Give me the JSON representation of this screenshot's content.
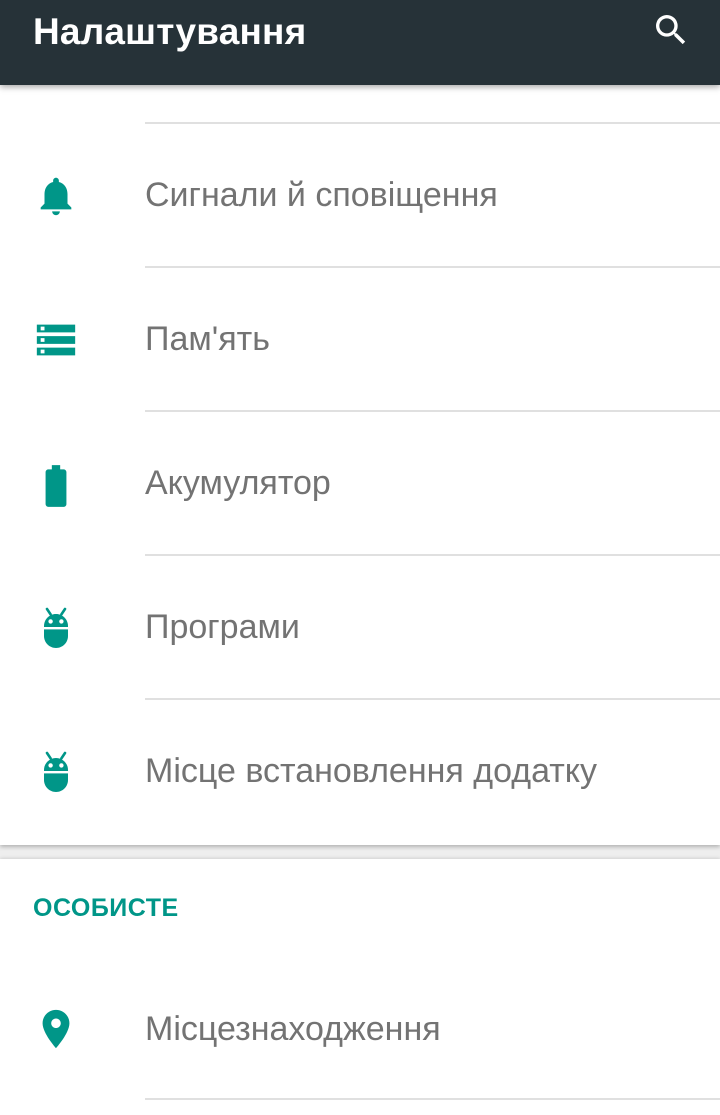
{
  "appbar": {
    "title": "Налаштування",
    "search_icon": "search-icon",
    "background": "#263238"
  },
  "accent_color": "#009688",
  "device_section": {
    "items": [
      {
        "label": "Сигнали й сповіщення",
        "icon": "bell-icon"
      },
      {
        "label": "Пам'ять",
        "icon": "storage-icon"
      },
      {
        "label": "Акумулятор",
        "icon": "battery-icon"
      },
      {
        "label": "Програми",
        "icon": "android-icon"
      },
      {
        "label": "Місце встановлення додатку",
        "icon": "android-icon"
      }
    ]
  },
  "personal_section": {
    "header": "ОСОБИСТЕ",
    "items": [
      {
        "label": "Місцезнаходження",
        "icon": "location-pin-icon"
      }
    ]
  }
}
